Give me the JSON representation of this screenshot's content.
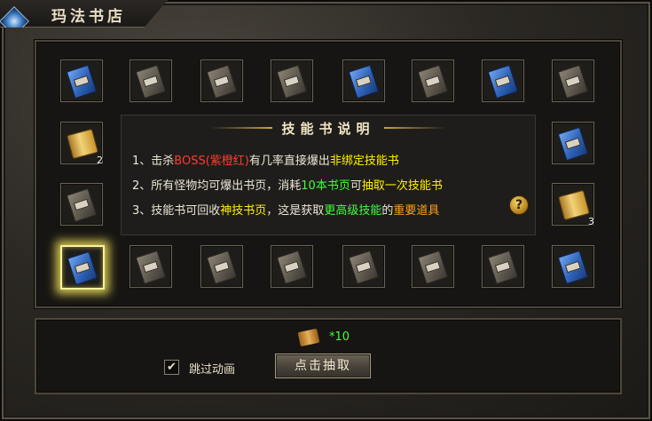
{
  "window": {
    "title": "玛法书店"
  },
  "slots": [
    {
      "item": "blue-book",
      "count": ""
    },
    {
      "item": "gray-book",
      "count": ""
    },
    {
      "item": "gray-book",
      "count": ""
    },
    {
      "item": "gray-book",
      "count": ""
    },
    {
      "item": "blue-book",
      "count": ""
    },
    {
      "item": "gray-book",
      "count": ""
    },
    {
      "item": "blue-book",
      "count": ""
    },
    {
      "item": "gray-book",
      "count": ""
    },
    {
      "item": "gold-scroll",
      "count": "2"
    },
    {
      "item": "blue-book",
      "count": ""
    },
    {
      "item": "gray-book",
      "count": ""
    },
    {
      "item": "gold-scroll",
      "count": "3"
    },
    {
      "item": "blue-book",
      "count": "",
      "selected": true
    },
    {
      "item": "gray-book",
      "count": ""
    },
    {
      "item": "gray-book",
      "count": ""
    },
    {
      "item": "gray-book",
      "count": ""
    },
    {
      "item": "gray-book",
      "count": ""
    },
    {
      "item": "gray-book",
      "count": ""
    },
    {
      "item": "gray-book",
      "count": ""
    },
    {
      "item": "blue-book",
      "count": ""
    }
  ],
  "info": {
    "title": "技能书说明",
    "line1": {
      "prefix": "1、击杀",
      "boss": "BOSS(紫橙红)",
      "mid": "有几率直接爆出",
      "bound": "非绑定技能书"
    },
    "line2": {
      "prefix": "2、所有怪物均可爆出书页，消耗",
      "pages": "10本书页",
      "mid": "可",
      "draw": "抽取一次技能书"
    },
    "line3": {
      "prefix": "3、技能书可回收",
      "god": "神技书页",
      "mid": "，这是获取",
      "higher": "更高级技能",
      "de": "的",
      "important": "重要道具"
    },
    "help_icon": "?"
  },
  "bottom": {
    "cost": "*10",
    "skip_animation_label": "跳过动画",
    "skip_checked": true,
    "check_mark": "✔",
    "draw_button": "点击抽取"
  },
  "colors": {
    "red": "#ff3b2b",
    "yellow": "#fff200",
    "green": "#41ff3c",
    "orange": "#ff9c1a"
  }
}
